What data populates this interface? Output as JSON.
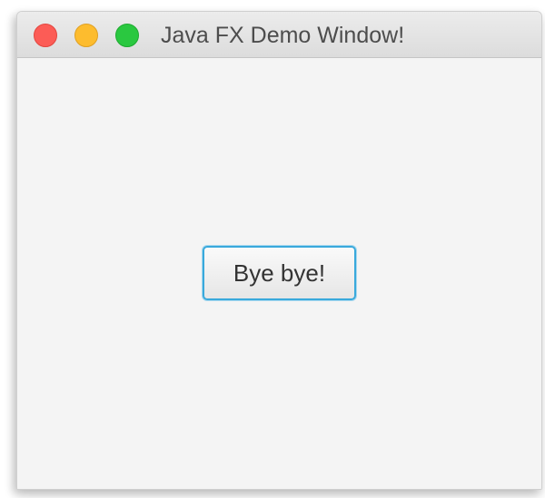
{
  "window": {
    "title": "Java FX Demo Window!",
    "controls": {
      "close_icon": "close-icon",
      "minimize_icon": "minimize-icon",
      "zoom_icon": "zoom-icon"
    },
    "colors": {
      "close": "#fc5c56",
      "minimize": "#fdbc2e",
      "zoom": "#2ac840",
      "focus_ring": "#39a9dc"
    }
  },
  "main": {
    "button_label": "Bye bye!"
  }
}
